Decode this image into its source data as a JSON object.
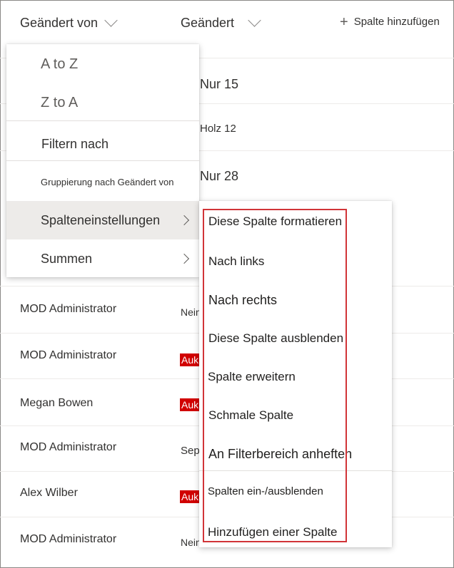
{
  "header": {
    "col_changed_by": "Geändert von",
    "col_changed": "Geändert",
    "add_column": "Spalte hinzufügen"
  },
  "rows": {
    "r1": "Nur 15",
    "r2": "Holz 12",
    "r3": "Nur 28",
    "r7_name": "MOD Administrator",
    "r7_val": "Nein",
    "r8_name": "MOD Administrator",
    "r8_val": "Auk",
    "r9_name": "Megan Bowen",
    "r9_val": "Auk",
    "r10_name": "MOD Administrator",
    "r10_val": "Sep",
    "r11_name": "Alex Wilber",
    "r11_val": "Auk",
    "r12_name": "MOD Administrator",
    "r12_val": "Nein"
  },
  "column_menu": {
    "sort_az": "A to Z",
    "sort_za": "Z to A",
    "filter": "Filtern nach",
    "group": "Gruppierung nach Geändert von",
    "column_settings": "Spalteneinstellungen",
    "totals": "Summen"
  },
  "settings_menu": {
    "format": "Diese Spalte formatieren",
    "move_left": "Nach links",
    "move_right": "Nach rechts",
    "hide": "Diese Spalte ausblenden",
    "widen": "Spalte erweitern",
    "narrow": "Schmale Spalte",
    "pin": "An Filterbereich anheften",
    "show_hide": "Spalten ein-/ausblenden",
    "add": "Hinzufügen einer Spalte"
  },
  "colors": {
    "highlight": "#d13438",
    "tag": "#d10000",
    "hover": "#edebe9"
  }
}
